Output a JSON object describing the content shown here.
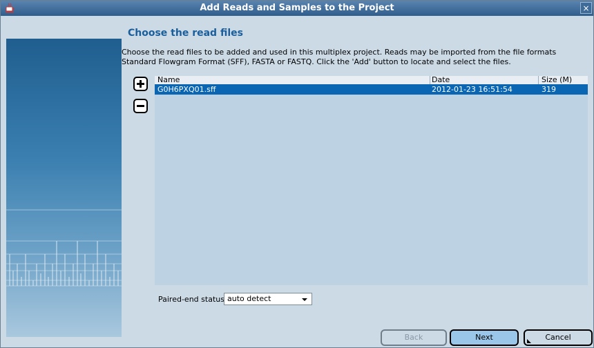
{
  "window": {
    "title": "Add Reads and Samples to the Project",
    "close_glyph": "×"
  },
  "page": {
    "heading": "Choose the read files",
    "description": "Choose the read files to be added and used in this multiplex project. Reads may be imported from the file formats Standard Flowgram Format (SFF), FASTA or FASTQ. Click the 'Add' button to locate and select the files."
  },
  "toolbar": {
    "add_icon": "plus-icon",
    "remove_icon": "minus-icon"
  },
  "table": {
    "columns": [
      "Name",
      "Date",
      "Size (M)"
    ],
    "rows": [
      {
        "name": "G0H6PXQ01.sff",
        "date": "2012-01-23 16:51:54",
        "size": "319",
        "selected": true
      }
    ]
  },
  "paired_end": {
    "label": "Paired-end status:",
    "value": "auto detect"
  },
  "buttons": {
    "back": "Back",
    "next": "Next",
    "cancel": "Cancel"
  },
  "colors": {
    "title_bar": "#3f6b99",
    "heading": "#1a5e9c",
    "selection": "#0a66b3",
    "background": "#ccdae6"
  }
}
